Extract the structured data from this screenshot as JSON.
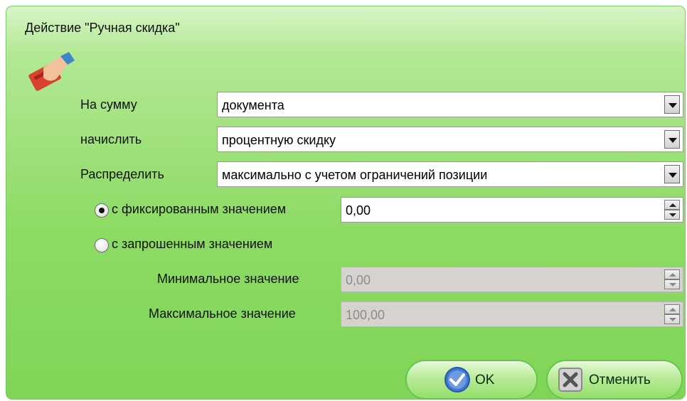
{
  "window": {
    "title": "Действие \"Ручная скидка\""
  },
  "icon": "hand-card-icon",
  "form": {
    "amount_label": "На сумму",
    "amount_value": "документа",
    "accrue_label": "начислить",
    "accrue_value": "процентную скидку",
    "distribute_label": "Распределить",
    "distribute_value": "максимально с учетом ограничений позиции",
    "fixed_radio_label": "с фиксированным значением",
    "fixed_value": "0,00",
    "requested_radio_label": "с запрошенным значением",
    "min_label": "Минимальное значение",
    "min_value": "0,00",
    "max_label": "Максимальное значение",
    "max_value": "100,00",
    "selected_mode": "fixed"
  },
  "buttons": {
    "ok_label": "OK",
    "cancel_label": "Отменить"
  },
  "colors": {
    "window_green": "#8edb66",
    "ok_blue": "#3e78d6",
    "disabled_gray": "#d6d3cf"
  }
}
